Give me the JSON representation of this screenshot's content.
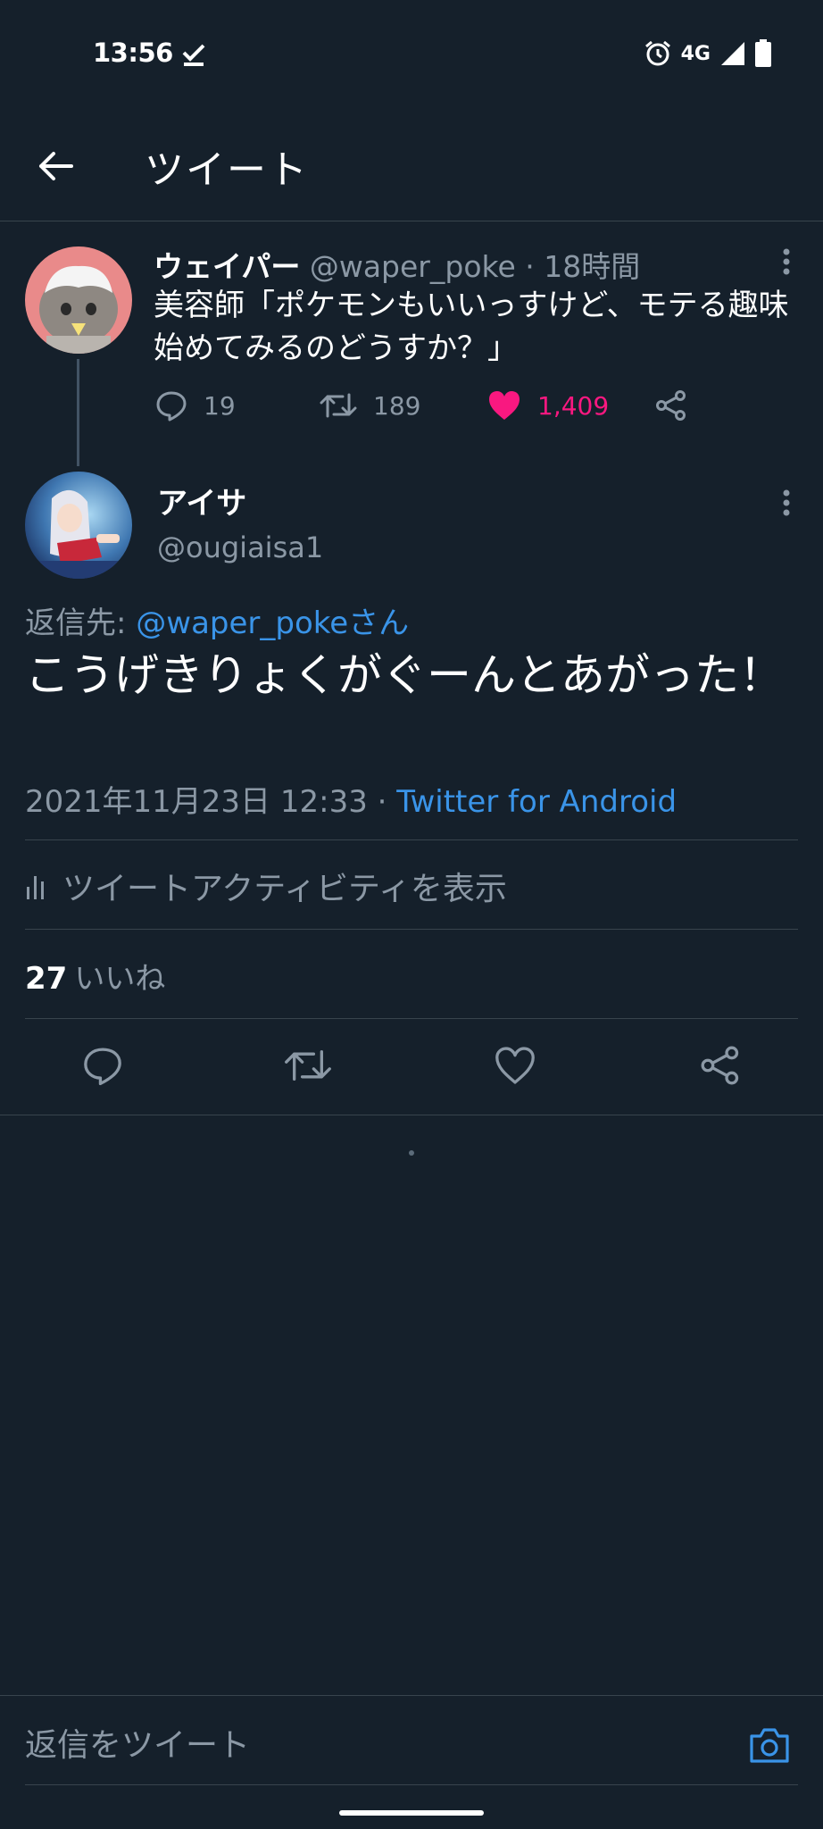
{
  "status_bar": {
    "time": "13:56",
    "network": "4G",
    "icons": [
      "download-done-icon",
      "alarm-icon",
      "signal-icon",
      "battery-icon"
    ]
  },
  "header": {
    "title": "ツイート",
    "back_icon": "back-arrow-icon"
  },
  "parent_tweet": {
    "name": "ウェイパー",
    "handle": "@waper_poke",
    "separator": " · ",
    "time": "18時間",
    "text": "美容師「ポケモンもいいっすけど、モテる趣味始めてみるのどうすか？」",
    "replies": "19",
    "retweets": "189",
    "likes": "1,409",
    "liked": true
  },
  "main_tweet": {
    "name": "アイサ",
    "handle": "@ougiaisa1",
    "reply_prefix": "返信先: ",
    "reply_mention": "@waper_pokeさん",
    "text": "こうげきりょくがぐーんとあがった！",
    "timestamp": "2021年11月23日 12:33",
    "meta_separator": " · ",
    "source": "Twitter for Android",
    "activity_label": "ツイートアクティビティを表示",
    "likes_count": "27",
    "likes_label": "いいね"
  },
  "composer": {
    "placeholder": "返信をツイート"
  },
  "colors": {
    "background": "#15202b",
    "accent": "#1d9bf0",
    "like": "#f91880",
    "muted": "#8b98a5",
    "divider": "#38444d"
  }
}
